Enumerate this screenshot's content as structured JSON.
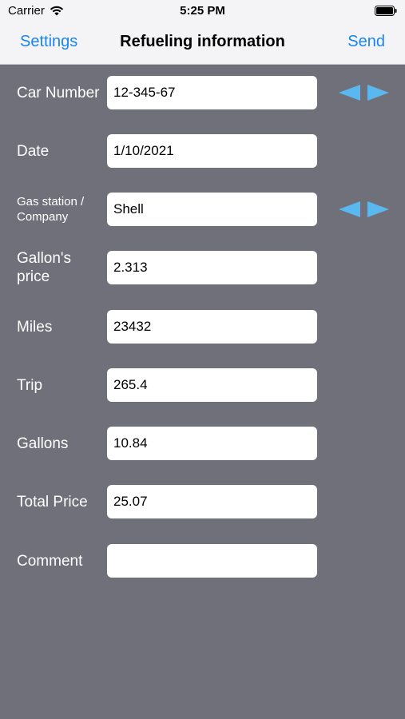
{
  "status_bar": {
    "carrier": "Carrier",
    "time": "5:25 PM"
  },
  "nav": {
    "left_button": "Settings",
    "title": "Refueling information",
    "right_button": "Send"
  },
  "form": {
    "car_number": {
      "label": "Car Number",
      "value": "12-345-67"
    },
    "date": {
      "label": "Date",
      "value": "1/10/2021"
    },
    "gas_station": {
      "label": "Gas station / Company",
      "value": "Shell"
    },
    "gallon_price": {
      "label": "Gallon's price",
      "value": "2.313"
    },
    "miles": {
      "label": "Miles",
      "value": "23432"
    },
    "trip": {
      "label": "Trip",
      "value": "265.4"
    },
    "gallons": {
      "label": "Gallons",
      "value": "10.84"
    },
    "total_price": {
      "label": "Total Price",
      "value": "25.07"
    },
    "comment": {
      "label": "Comment",
      "value": ""
    }
  },
  "colors": {
    "background": "#6f7079",
    "accent": "#1a84f0",
    "arrow": "#5ab8f0"
  },
  "icons": {
    "wifi": "wifi-icon",
    "battery": "battery-icon",
    "previous": "triangle-left-icon",
    "next": "triangle-right-icon"
  }
}
